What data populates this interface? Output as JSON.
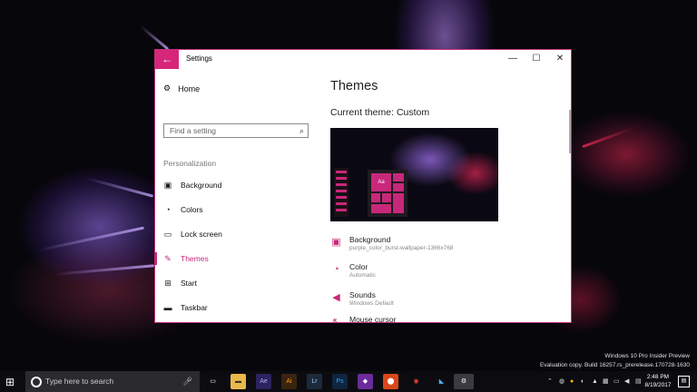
{
  "window": {
    "title": "Settings",
    "back_icon": "arrow-left-icon",
    "controls": {
      "minimize": "—",
      "maximize": "☐",
      "close": "✕"
    }
  },
  "sidebar": {
    "home_label": "Home",
    "search_placeholder": "Find a setting",
    "section_label": "Personalization",
    "items": [
      {
        "label": "Background",
        "icon": "picture-icon"
      },
      {
        "label": "Colors",
        "icon": "palette-icon"
      },
      {
        "label": "Lock screen",
        "icon": "lock-screen-icon"
      },
      {
        "label": "Themes",
        "icon": "brush-icon",
        "active": true
      },
      {
        "label": "Start",
        "icon": "start-grid-icon"
      },
      {
        "label": "Taskbar",
        "icon": "taskbar-icon"
      }
    ]
  },
  "main": {
    "title": "Themes",
    "current_theme": "Current theme: Custom",
    "preview_tile_label": "Aa",
    "settings": [
      {
        "title": "Background",
        "subtitle": "purple_color_burst-wallpaper-1366x768",
        "icon": "picture-icon"
      },
      {
        "title": "Color",
        "subtitle": "Automatic",
        "icon": "palette-icon"
      },
      {
        "title": "Sounds",
        "subtitle": "Windows Default",
        "icon": "speaker-icon"
      },
      {
        "title": "Mouse cursor",
        "subtitle": "",
        "icon": "cursor-icon"
      }
    ]
  },
  "watermark": {
    "line1": "Windows 10 Pro Insider Preview",
    "line2": "Evaluation copy. Build 16257.rs_prerelease.170728-1630"
  },
  "taskbar": {
    "search_placeholder": "Type here to search",
    "apps": [
      {
        "name": "task-view",
        "label": "▭",
        "color": "#0c0c10"
      },
      {
        "name": "file-explorer",
        "label": "▬",
        "color": "#e8b84a"
      },
      {
        "name": "after-effects",
        "label": "Ae",
        "color": "#2b2460"
      },
      {
        "name": "illustrator",
        "label": "Ai",
        "color": "#3a2410"
      },
      {
        "name": "lightroom",
        "label": "Lr",
        "color": "#1c2a3a"
      },
      {
        "name": "photoshop",
        "label": "Ps",
        "color": "#0f2540"
      },
      {
        "name": "visual-studio",
        "label": "◆",
        "color": "#6a2c9a"
      },
      {
        "name": "app-orange",
        "label": "⬤",
        "color": "#d9471a"
      },
      {
        "name": "chrome",
        "label": "◉",
        "color": "#1a1a1a"
      },
      {
        "name": "app-blue",
        "label": "◣",
        "color": "#1a1a1a"
      },
      {
        "name": "settings",
        "label": "⚙",
        "color": "#3a3a40"
      }
    ],
    "clock_time": "2:48 PM",
    "clock_date": "8/19/2017"
  }
}
